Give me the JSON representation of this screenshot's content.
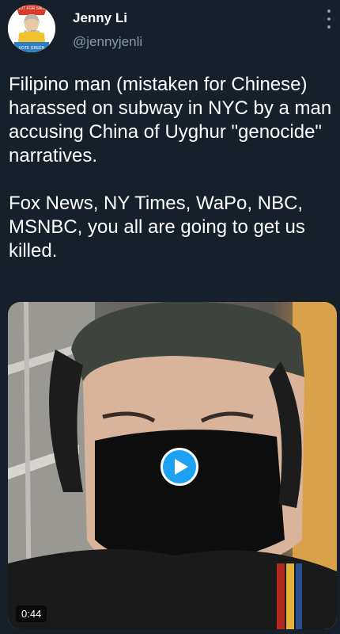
{
  "tweet": {
    "author_name": "Jenny Li",
    "author_handle": "@jennyjenli",
    "avatar": {
      "sign_text_top": "NOT FOR SALE",
      "sign_text_mid": "JILL STEIN",
      "sign_text_bottom": "VOTE GREEN"
    },
    "text": "Filipino man (mistaken for Chinese) harassed on subway in NYC by a man accusing China of Uyghur \"genocide\" narratives.\n\nFox News, NY Times, WaPo, NBC, MSNBC, you all are going to get us killed.",
    "video": {
      "duration": "0:44",
      "play_icon": "play-icon"
    },
    "more_icon": "more-vertical-icon"
  },
  "colors": {
    "background": "#15202b",
    "text": "#ffffff",
    "secondary_text": "#8899a6",
    "accent": "#1da1f2"
  }
}
